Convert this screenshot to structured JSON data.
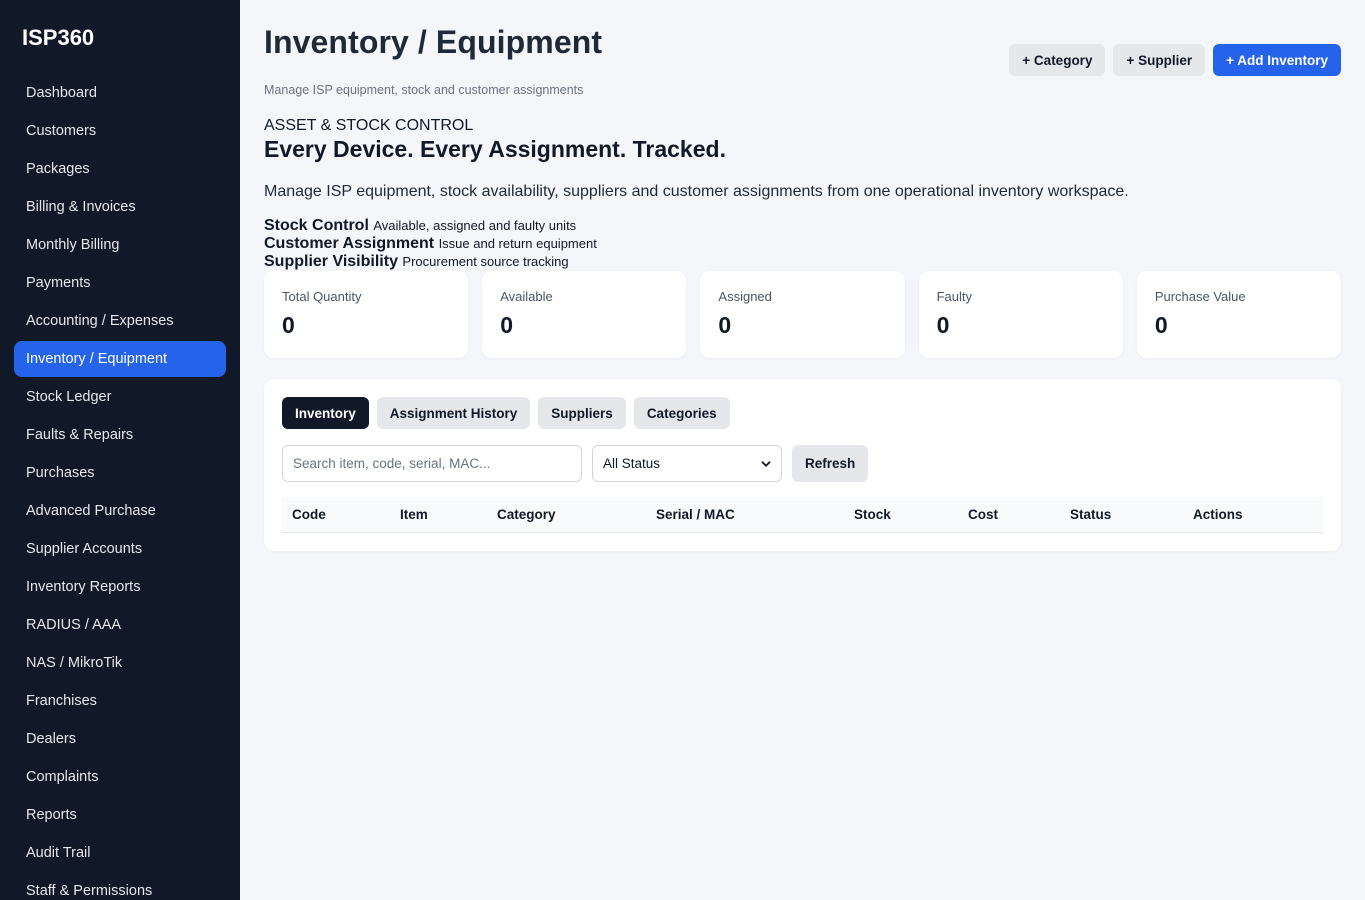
{
  "sidebar": {
    "brand": "ISP360",
    "items": [
      {
        "label": "Dashboard"
      },
      {
        "label": "Customers"
      },
      {
        "label": "Packages"
      },
      {
        "label": "Billing & Invoices"
      },
      {
        "label": "Monthly Billing"
      },
      {
        "label": "Payments"
      },
      {
        "label": "Accounting / Expenses"
      },
      {
        "label": "Inventory / Equipment",
        "active": true
      },
      {
        "label": "Stock Ledger"
      },
      {
        "label": "Faults & Repairs"
      },
      {
        "label": "Purchases"
      },
      {
        "label": "Advanced Purchase"
      },
      {
        "label": "Supplier Accounts"
      },
      {
        "label": "Inventory Reports"
      },
      {
        "label": "RADIUS / AAA"
      },
      {
        "label": "NAS / MikroTik"
      },
      {
        "label": "Franchises"
      },
      {
        "label": "Dealers"
      },
      {
        "label": "Complaints"
      },
      {
        "label": "Reports"
      },
      {
        "label": "Audit Trail"
      },
      {
        "label": "Staff & Permissions"
      }
    ]
  },
  "header": {
    "title": "Inventory / Equipment",
    "subtitle": "Manage ISP equipment, stock and customer assignments",
    "actions": {
      "category": "+ Category",
      "supplier": "+ Supplier",
      "add_inventory": "+ Add Inventory"
    }
  },
  "hero": {
    "eyebrow": "ASSET & STOCK CONTROL",
    "heading": "Every Device. Every Assignment. Tracked.",
    "description": "Manage ISP equipment, stock availability, suppliers and customer assignments from one operational inventory workspace.",
    "features": [
      {
        "title": "Stock Control",
        "text": "Available, assigned and faulty units"
      },
      {
        "title": "Customer Assignment",
        "text": "Issue and return equipment"
      },
      {
        "title": "Supplier Visibility",
        "text": "Procurement source tracking"
      }
    ]
  },
  "stats": [
    {
      "label": "Total Quantity",
      "value": "0"
    },
    {
      "label": "Available",
      "value": "0"
    },
    {
      "label": "Assigned",
      "value": "0"
    },
    {
      "label": "Faulty",
      "value": "0"
    },
    {
      "label": "Purchase Value",
      "value": "0"
    }
  ],
  "panel": {
    "tabs": [
      {
        "label": "Inventory",
        "active": true
      },
      {
        "label": "Assignment History"
      },
      {
        "label": "Suppliers"
      },
      {
        "label": "Categories"
      }
    ],
    "search": {
      "placeholder": "Search item, code, serial, MAC...",
      "value": ""
    },
    "status_filter": {
      "selected": "All Status"
    },
    "refresh_label": "Refresh",
    "columns": [
      "Code",
      "Item",
      "Category",
      "Serial / MAC",
      "Stock",
      "Cost",
      "Status",
      "Actions"
    ]
  },
  "colors": {
    "sidebar_bg": "#111827",
    "accent": "#2563eb",
    "page_bg": "#f4f6fa"
  }
}
